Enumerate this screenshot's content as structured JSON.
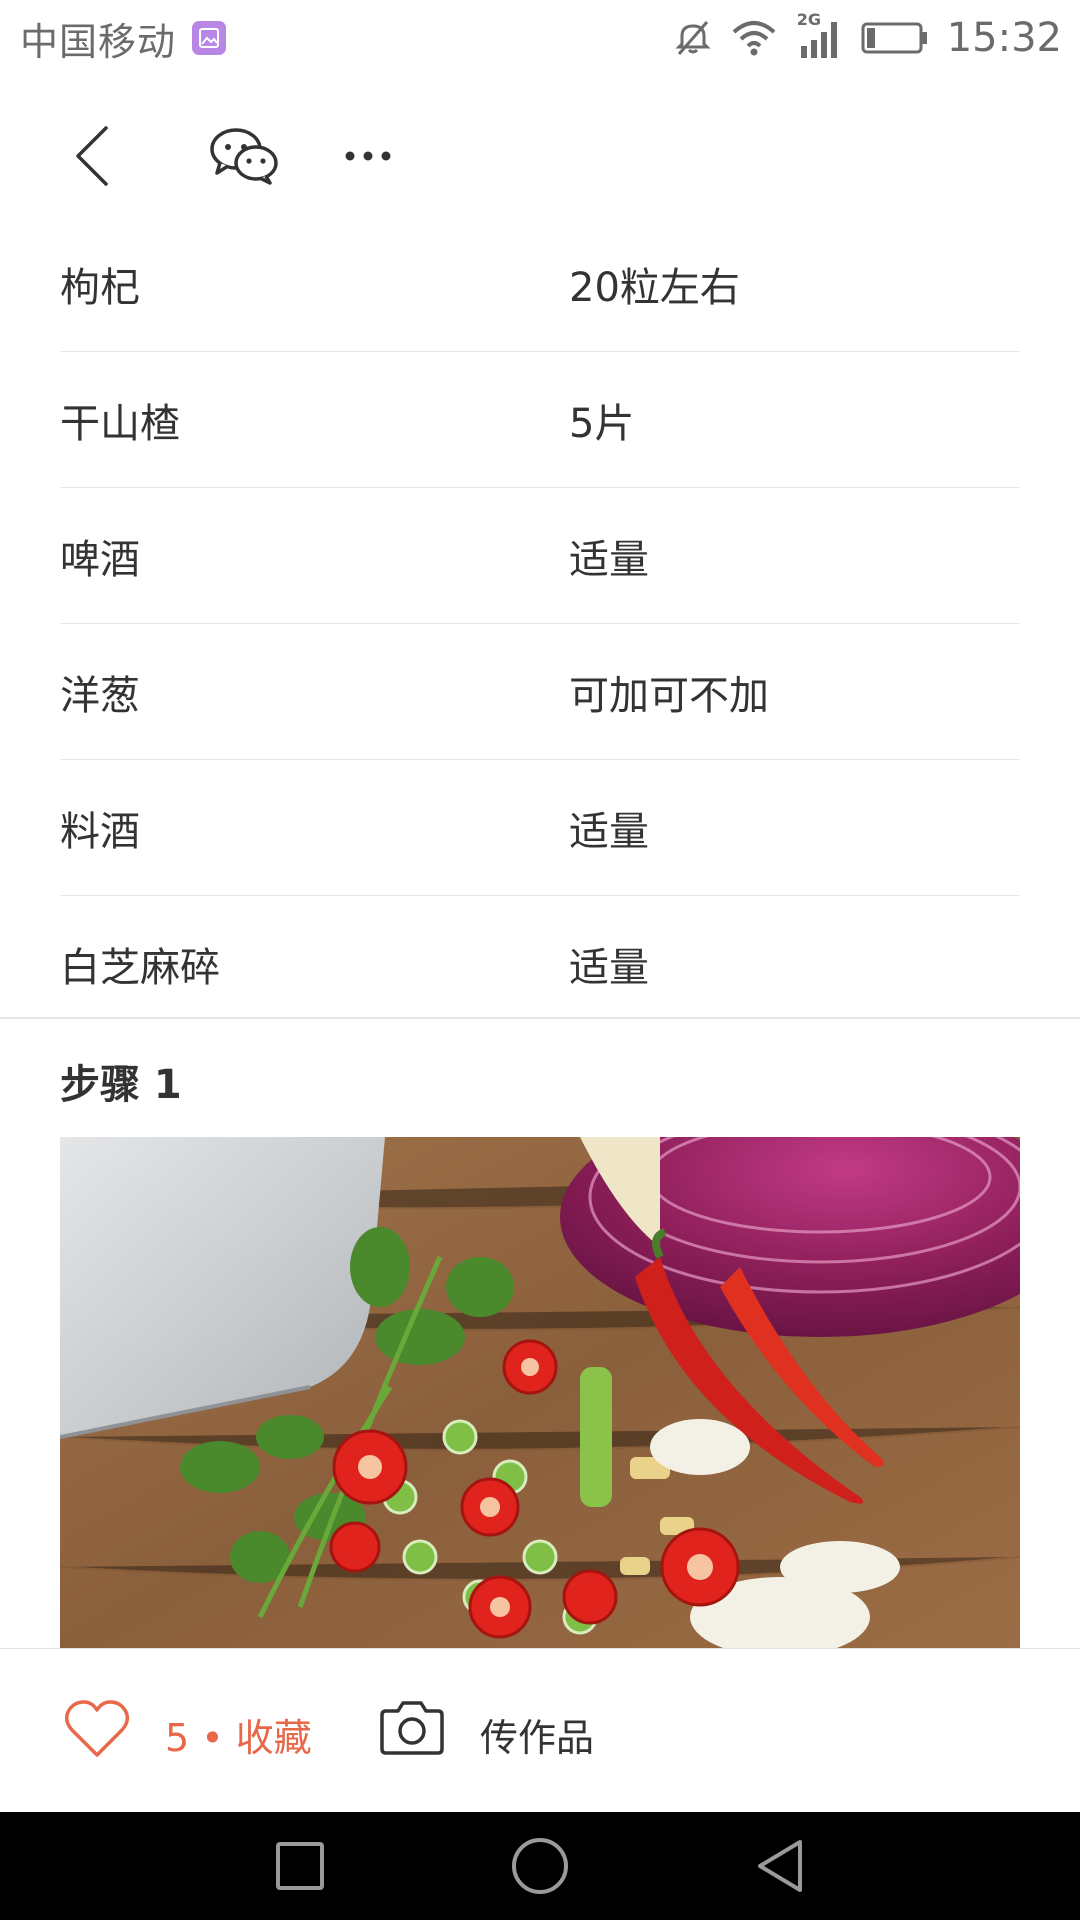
{
  "status_bar": {
    "carrier": "中国移动",
    "network_type": "2G",
    "time": "15:32",
    "icons": [
      "gallery-notification-icon",
      "mute-icon",
      "wifi-icon",
      "signal-icon",
      "battery-icon"
    ]
  },
  "toolbar": {
    "icons": [
      "back-arrow-icon",
      "wechat-share-icon",
      "more-dots-icon"
    ]
  },
  "ingredients": [
    {
      "name": "枸杞",
      "amount": "20粒左右"
    },
    {
      "name": "干山楂",
      "amount": "5片"
    },
    {
      "name": "啤酒",
      "amount": "适量"
    },
    {
      "name": "洋葱",
      "amount": "可加可不加"
    },
    {
      "name": "料酒",
      "amount": "适量"
    },
    {
      "name": "白芝麻碎",
      "amount": "适量"
    }
  ],
  "step": {
    "title": "步骤 1",
    "photo_icon": "chopped-vegetables-photo"
  },
  "action_bar": {
    "favorite_text": "5 • 收藏",
    "upload_text": "传作品",
    "accent_color": "#e8684a",
    "icons": [
      "heart-icon",
      "camera-icon"
    ]
  },
  "nav_bar": {
    "icons": [
      "recent-apps-icon",
      "home-icon",
      "back-icon"
    ]
  }
}
